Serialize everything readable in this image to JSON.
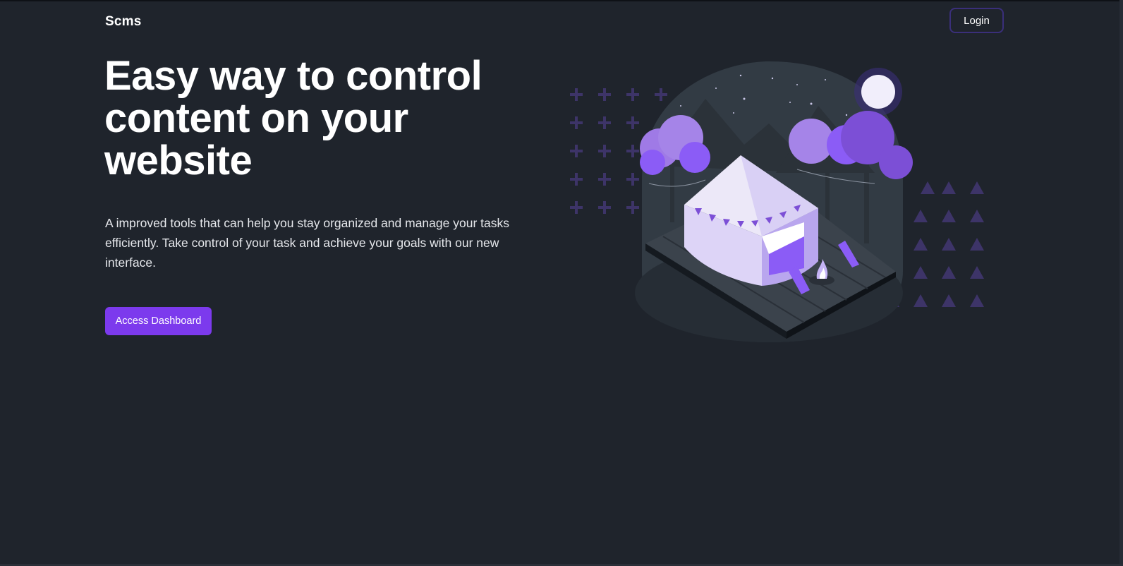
{
  "navbar": {
    "brand": "Scms",
    "login_label": "Login"
  },
  "hero": {
    "title": "Easy way to control content on your website",
    "description": "A improved tools that can help you stay organized and manage your tasks efficiently. Take control of your task and achieve your goals with our new interface.",
    "cta_label": "Access Dashboard"
  },
  "colors": {
    "background": "#1f242c",
    "accent": "#7c3aed",
    "login_border": "#3a2f7a",
    "illustration_purple": "#8b5cf6"
  },
  "illustration": {
    "icon": "camping-tent-illustration"
  }
}
